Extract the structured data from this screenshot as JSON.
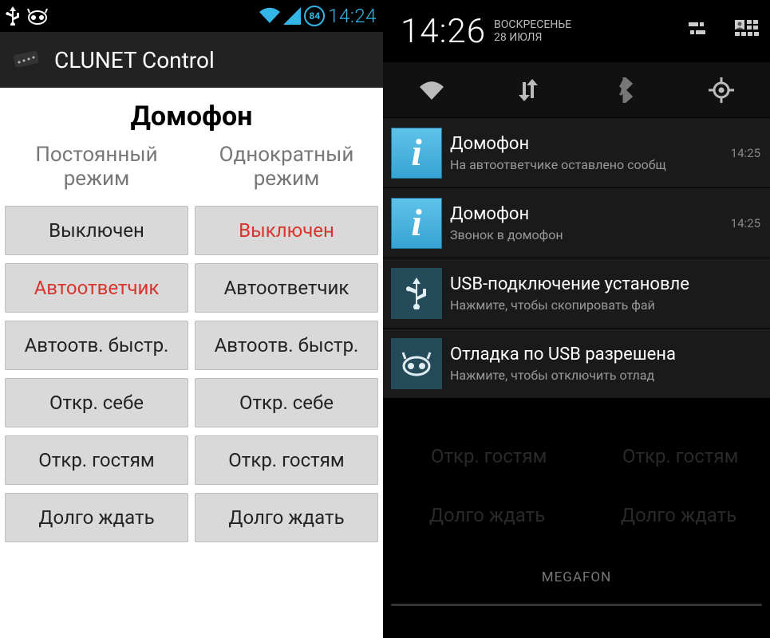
{
  "left": {
    "statusbar": {
      "time": "14:24",
      "battery": "84"
    },
    "app_title": "CLUNET Control",
    "page_title": "Домофон",
    "columns": [
      {
        "header": "Постоянный режим",
        "selected_index": 1
      },
      {
        "header": "Однократный режим",
        "selected_index": 0
      }
    ],
    "buttons": [
      "Выключен",
      "Автоответчик",
      "Автоотв. быстр.",
      "Откр. себе",
      "Откр. гостям",
      "Долго ждать"
    ]
  },
  "right": {
    "header": {
      "time": "14:26",
      "day": "ВОСКРЕСЕНЬЕ",
      "date": "28 ИЮЛЯ"
    },
    "notifications": [
      {
        "icon": "info",
        "title": "Домофон",
        "body": "На автоответчике оставлено сообщ",
        "time": "14:25"
      },
      {
        "icon": "info",
        "title": "Домофон",
        "body": "Звонок в домофон",
        "time": "14:25"
      },
      {
        "icon": "usb",
        "title": "USB-подключение установле",
        "body": "Нажмите, чтобы скопировать фай",
        "time": ""
      },
      {
        "icon": "cm",
        "title": "Отладка по USB разрешена",
        "body": "Нажмите, чтобы отключить отлад",
        "time": ""
      }
    ],
    "ghost_buttons": {
      "g1": "Откр. гостям",
      "g2": "Откр. гостям",
      "g3": "Долго ждать",
      "g4": "Долго ждать"
    },
    "carrier": "MEGAFON"
  }
}
